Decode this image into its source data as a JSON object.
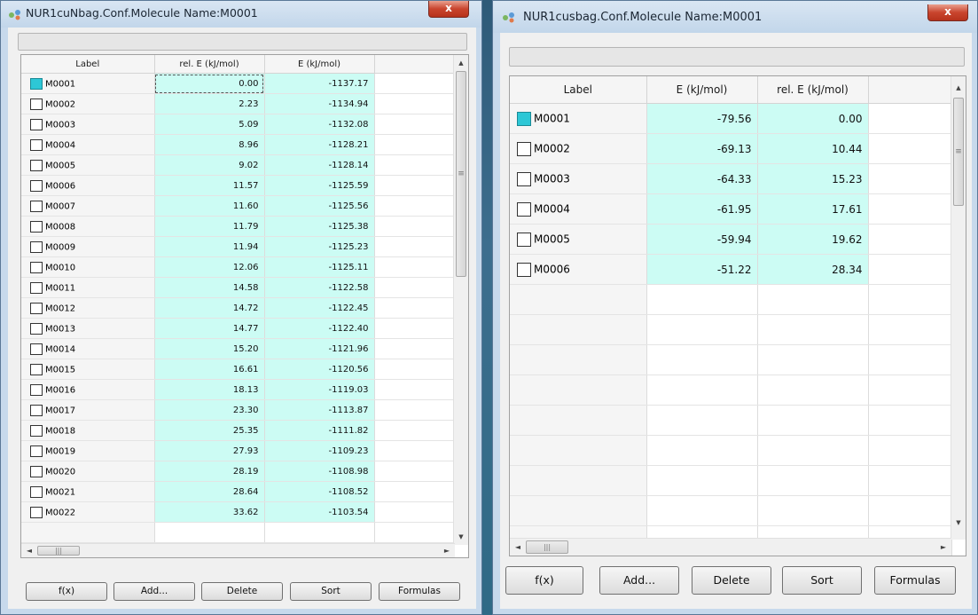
{
  "left_window": {
    "title": "NUR1cuNbag.Conf.Molecule Name:M0001",
    "close_label": "x",
    "columns": [
      "Label",
      "rel. E (kJ/mol)",
      "E (kJ/mol)"
    ],
    "rows": [
      {
        "label": "M0001",
        "rel": "0.00",
        "e": "-1137.17",
        "checked": true
      },
      {
        "label": "M0002",
        "rel": "2.23",
        "e": "-1134.94",
        "checked": false
      },
      {
        "label": "M0003",
        "rel": "5.09",
        "e": "-1132.08",
        "checked": false
      },
      {
        "label": "M0004",
        "rel": "8.96",
        "e": "-1128.21",
        "checked": false
      },
      {
        "label": "M0005",
        "rel": "9.02",
        "e": "-1128.14",
        "checked": false
      },
      {
        "label": "M0006",
        "rel": "11.57",
        "e": "-1125.59",
        "checked": false
      },
      {
        "label": "M0007",
        "rel": "11.60",
        "e": "-1125.56",
        "checked": false
      },
      {
        "label": "M0008",
        "rel": "11.79",
        "e": "-1125.38",
        "checked": false
      },
      {
        "label": "M0009",
        "rel": "11.94",
        "e": "-1125.23",
        "checked": false
      },
      {
        "label": "M0010",
        "rel": "12.06",
        "e": "-1125.11",
        "checked": false
      },
      {
        "label": "M0011",
        "rel": "14.58",
        "e": "-1122.58",
        "checked": false
      },
      {
        "label": "M0012",
        "rel": "14.72",
        "e": "-1122.45",
        "checked": false
      },
      {
        "label": "M0013",
        "rel": "14.77",
        "e": "-1122.40",
        "checked": false
      },
      {
        "label": "M0014",
        "rel": "15.20",
        "e": "-1121.96",
        "checked": false
      },
      {
        "label": "M0015",
        "rel": "16.61",
        "e": "-1120.56",
        "checked": false
      },
      {
        "label": "M0016",
        "rel": "18.13",
        "e": "-1119.03",
        "checked": false
      },
      {
        "label": "M0017",
        "rel": "23.30",
        "e": "-1113.87",
        "checked": false
      },
      {
        "label": "M0018",
        "rel": "25.35",
        "e": "-1111.82",
        "checked": false
      },
      {
        "label": "M0019",
        "rel": "27.93",
        "e": "-1109.23",
        "checked": false
      },
      {
        "label": "M0020",
        "rel": "28.19",
        "e": "-1108.98",
        "checked": false
      },
      {
        "label": "M0021",
        "rel": "28.64",
        "e": "-1108.52",
        "checked": false
      },
      {
        "label": "M0022",
        "rel": "33.62",
        "e": "-1103.54",
        "checked": false
      }
    ],
    "buttons": {
      "fx": "f(x)",
      "add": "Add...",
      "delete": "Delete",
      "sort": "Sort",
      "formulas": "Formulas"
    }
  },
  "right_window": {
    "title": "NUR1cusbag.Conf.Molecule Name:M0001",
    "close_label": "x",
    "columns": [
      "Label",
      "E (kJ/mol)",
      "rel. E (kJ/mol)"
    ],
    "rows": [
      {
        "label": "M0001",
        "e": "-79.56",
        "rel": "0.00",
        "checked": true
      },
      {
        "label": "M0002",
        "e": "-69.13",
        "rel": "10.44",
        "checked": false
      },
      {
        "label": "M0003",
        "e": "-64.33",
        "rel": "15.23",
        "checked": false
      },
      {
        "label": "M0004",
        "e": "-61.95",
        "rel": "17.61",
        "checked": false
      },
      {
        "label": "M0005",
        "e": "-59.94",
        "rel": "19.62",
        "checked": false
      },
      {
        "label": "M0006",
        "e": "-51.22",
        "rel": "28.34",
        "checked": false
      }
    ],
    "buttons": {
      "fx": "f(x)",
      "add": "Add...",
      "delete": "Delete",
      "sort": "Sort",
      "formulas": "Formulas"
    }
  },
  "colors": {
    "data_cell": "#ccfcf4",
    "checked_box": "#2dc7d6",
    "titlebar": "#c7d9ec",
    "close_button": "#c9452e"
  },
  "icons": {
    "window_icon": "molecule-icon",
    "scroll_up": "arrow-up-icon",
    "scroll_down": "arrow-down-icon",
    "scroll_left": "arrow-left-icon",
    "scroll_right": "arrow-right-icon"
  }
}
